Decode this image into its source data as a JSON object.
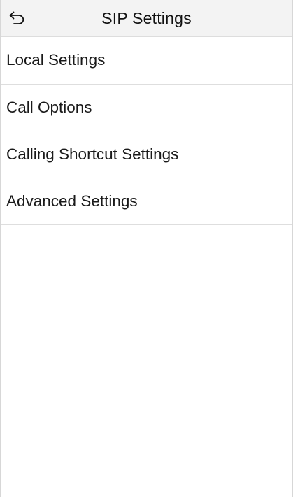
{
  "header": {
    "back_icon": "undo-arrow-icon",
    "title": "SIP Settings"
  },
  "menu": {
    "items": [
      {
        "label": "Local Settings"
      },
      {
        "label": "Call Options"
      },
      {
        "label": "Calling Shortcut Settings"
      },
      {
        "label": "Advanced Settings"
      }
    ]
  },
  "colors": {
    "background": "#ffffff",
    "header_background": "#f3f3f3",
    "divider": "#dedede",
    "text": "#1a1a1a"
  }
}
